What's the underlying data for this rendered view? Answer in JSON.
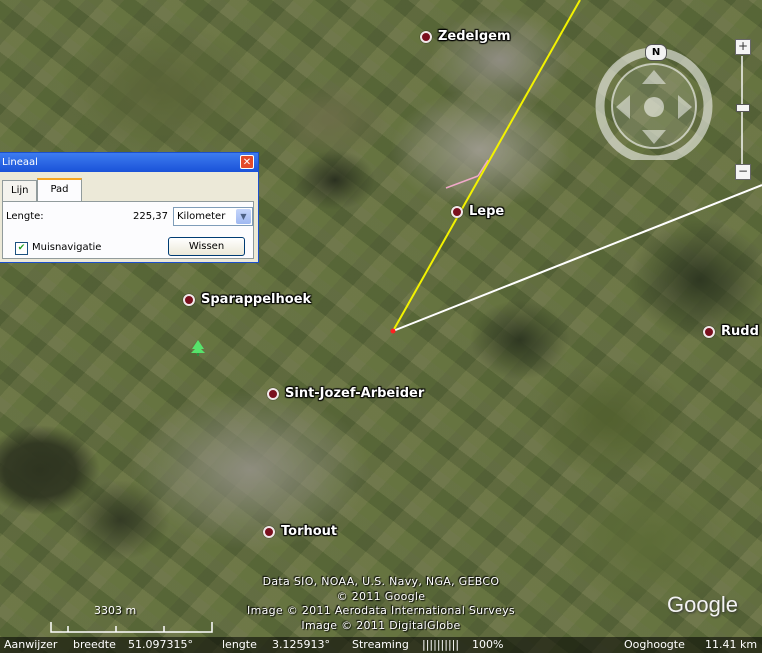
{
  "map": {
    "places": [
      {
        "name": "Zedelgem"
      },
      {
        "name": "Lepe"
      },
      {
        "name": "Sparappelhoek"
      },
      {
        "name": "Sint-Jozef-Arbeider"
      },
      {
        "name": "Torhout"
      },
      {
        "name": "Rudd"
      }
    ],
    "path_color": "#f2f200",
    "heading_line_color": "#ffffff",
    "attribution": [
      "Data SIO, NOAA, U.S. Navy, NGA, GEBCO",
      "© 2011 Google",
      "Image © 2011 Aerodata International Surveys",
      "Image © 2011 DigitalGlobe"
    ],
    "logo": "Google",
    "scale_label": "3303 m"
  },
  "ruler": {
    "title": "Lineaal",
    "close_label": "✕",
    "tabs": [
      {
        "label": "Lijn"
      },
      {
        "label": "Pad"
      }
    ],
    "length_label": "Lengte:",
    "length_value": "225,37",
    "unit": "Kilometer",
    "mouse_nav_label": "Muisnavigatie",
    "mouse_nav_checked": true,
    "clear_button": "Wissen"
  },
  "nav": {
    "north_label": "N",
    "zoom_in": "+",
    "zoom_out": "−",
    "zoom_level": 0.5
  },
  "status": {
    "pointer_label": "Aanwijzer",
    "lat_label": "breedte",
    "lat_value": "51.097315°",
    "lon_label": "lengte",
    "lon_value": "3.125913°",
    "streaming_label": "Streaming",
    "streaming_bars": "||||||||||",
    "streaming_percent": "100%",
    "eye_label": "Ooghoogte",
    "eye_value": "11.41 km"
  }
}
